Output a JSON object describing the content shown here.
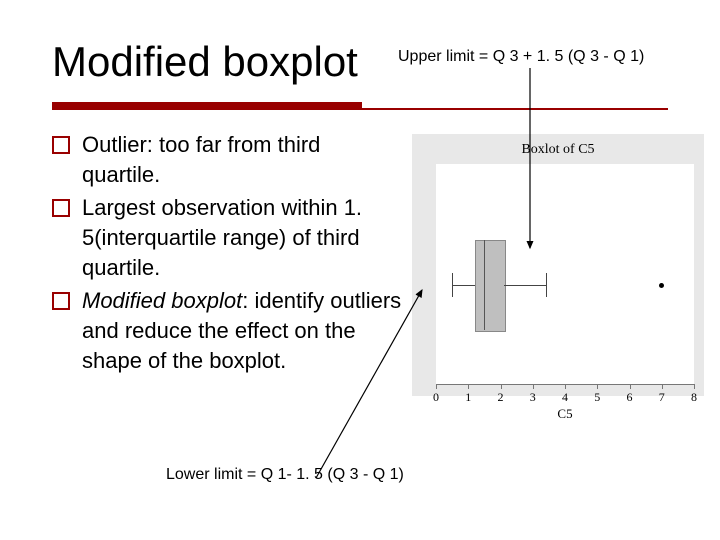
{
  "title": "Modified boxplot",
  "upper_limit_label": "Upper limit = Q 3 + 1. 5 (Q 3 - Q 1)",
  "lower_limit_label": "Lower limit = Q 1- 1. 5 (Q 3 - Q 1)",
  "bullets": [
    {
      "text_a": "Outlier: too far from third quartile."
    },
    {
      "text_a": "Largest  observation within 1. 5(interquartile range) of third quartile."
    },
    {
      "text_a": "",
      "italic": "Modified boxplot",
      "text_b": ": identify outliers and reduce the effect on the shape of the boxplot."
    }
  ],
  "chart_data": {
    "type": "boxplot",
    "title": "Boxlot of C5",
    "xlabel": "C5",
    "xlim": [
      0,
      8
    ],
    "ticks": [
      0,
      1,
      2,
      3,
      4,
      5,
      6,
      7,
      8
    ],
    "q1": 1.2,
    "median": 1.5,
    "q3": 2.1,
    "lower_whisker": 0.5,
    "upper_whisker": 3.4,
    "outliers": [
      7.0
    ]
  }
}
